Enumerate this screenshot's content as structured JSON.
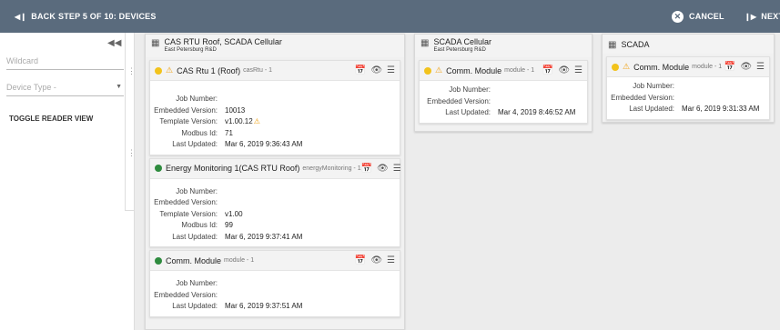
{
  "topbar": {
    "back_label": "BACK",
    "step_label": "STEP 5 OF 10: DEVICES",
    "cancel_label": "CANCEL",
    "next_label": "NEXT"
  },
  "sidebar": {
    "wildcard_placeholder": "Wildcard",
    "device_type_placeholder": "Device Type -",
    "toggle_label": "TOGGLE READER VIEW"
  },
  "labels": {
    "job_number": "Job Number:",
    "embedded_version": "Embedded Version:",
    "template_version": "Template Version:",
    "modbus_id": "Modbus Id:",
    "last_updated": "Last Updated:"
  },
  "columns": [
    {
      "title": "CAS RTU Roof, SCADA Cellular",
      "subtitle": "East Petersburg R&D",
      "cards": [
        {
          "name": "CAS Rtu 1 (Roof)",
          "meta": "casRtu - 1",
          "status": "yellow",
          "warn": true,
          "job_number": "",
          "embedded_version": "10013",
          "template_version": "v1.00.12",
          "modbus_id": "71",
          "last_updated": "Mar 6, 2019 9:36:43 AM"
        },
        {
          "name": "Energy Monitoring 1(CAS RTU Roof)",
          "meta": "energyMonitoring - 1",
          "status": "green",
          "warn": false,
          "job_number": "",
          "embedded_version": "",
          "template_version": "v1.00",
          "modbus_id": "99",
          "last_updated": "Mar 6, 2019 9:37:41 AM"
        },
        {
          "name": "Comm. Module",
          "meta": "module - 1",
          "status": "green",
          "warn": false,
          "job_number": "",
          "embedded_version": "",
          "last_updated": "Mar 6, 2019 9:37:51 AM"
        }
      ]
    },
    {
      "title": "SCADA Cellular",
      "subtitle": "East Petersburg R&D",
      "cards": [
        {
          "name": "Comm. Module",
          "meta": "module - 1",
          "status": "yellow",
          "warn": true,
          "job_number": "",
          "embedded_version": "",
          "last_updated": "Mar 4, 2019 8:46:52 AM"
        }
      ]
    },
    {
      "title": "SCADA",
      "subtitle": "",
      "cards": [
        {
          "name": "Comm. Module",
          "meta": "module - 1",
          "status": "yellow",
          "warn": true,
          "job_number": "",
          "embedded_version": "",
          "last_updated": "Mar 6, 2019 9:31:33 AM"
        }
      ]
    }
  ],
  "colors": {
    "topbar": "#5a6b7d",
    "yellow": "#f2c31c",
    "green": "#2e8b3e",
    "warning": "#f0a010"
  }
}
